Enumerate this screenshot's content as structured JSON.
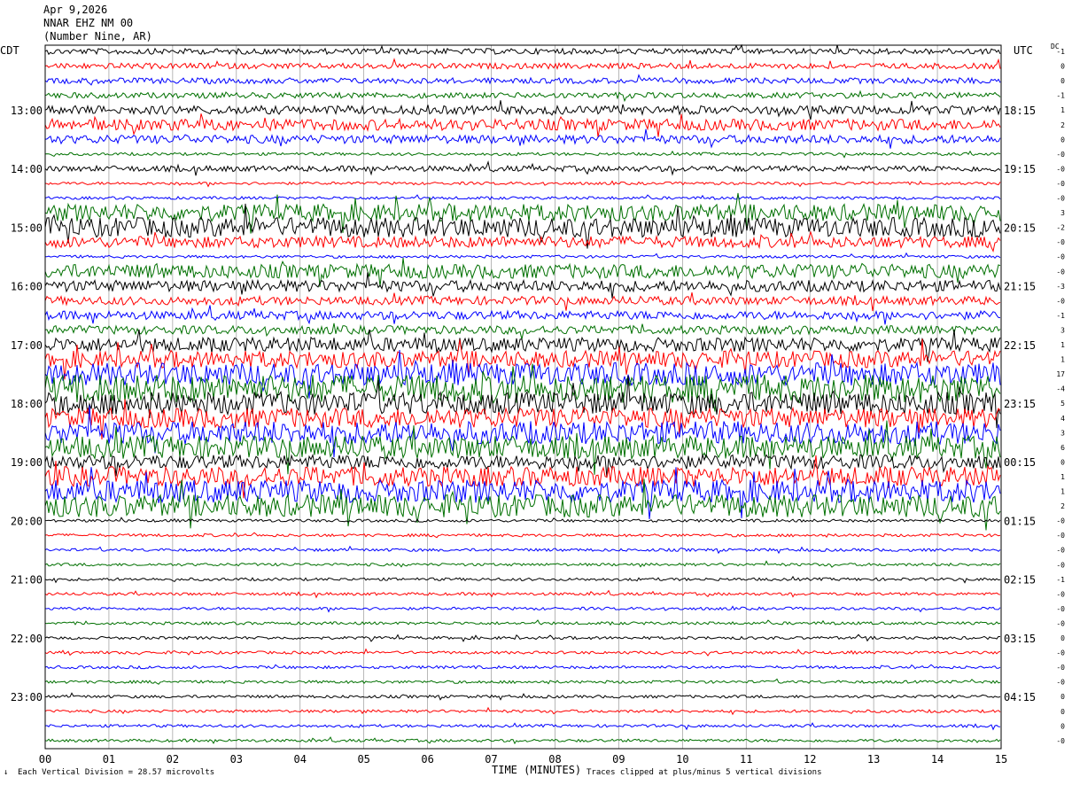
{
  "header": {
    "date": "Apr 9,2026",
    "station": "NNAR EHZ NM 00",
    "location": "(Number Nine, AR)"
  },
  "tz_left": "CDT",
  "tz_right": "UTC",
  "dc_label": "DC",
  "x_title": "TIME (MINUTES)",
  "footer_left": "Each Vertical Division =   28.57 microvolts",
  "footer_right": "Traces clipped at plus/minus 5 vertical divisions",
  "footer_mark": "↓",
  "chart_data": {
    "type": "line",
    "x_ticks": [
      "00",
      "01",
      "02",
      "03",
      "04",
      "05",
      "06",
      "07",
      "08",
      "09",
      "10",
      "11",
      "12",
      "13",
      "14",
      "15"
    ],
    "x_range": [
      0,
      15
    ],
    "left_hour_labels": [
      "13:00",
      "14:00",
      "15:00",
      "16:00",
      "17:00",
      "18:00",
      "19:00",
      "20:00",
      "21:00",
      "22:00",
      "23:00"
    ],
    "right_hour_labels": [
      "18:15",
      "19:15",
      "20:15",
      "21:15",
      "22:15",
      "23:15",
      "00:15",
      "01:15",
      "02:15",
      "03:15",
      "04:15"
    ],
    "trace_count": 48,
    "trace_colors": [
      "#000000",
      "#ff0000",
      "#0000ff",
      "#007000"
    ],
    "trace_amplitude": [
      2,
      2,
      2,
      2,
      3,
      4,
      3,
      1,
      2,
      1,
      1,
      6,
      7,
      4,
      1,
      5,
      4,
      3,
      3,
      3,
      5,
      6,
      8,
      10,
      8,
      7,
      8,
      8,
      5,
      7,
      8,
      8,
      1,
      1,
      1,
      1,
      1,
      1,
      1,
      1,
      1,
      1,
      1,
      1,
      1,
      1,
      1,
      1
    ],
    "dc_offsets": [
      "-1",
      "0",
      "0",
      "-1",
      "1",
      "2",
      "0",
      "-0",
      "-0",
      "-0",
      "-0",
      "3",
      "-2",
      "-0",
      "-0",
      "-0",
      "-3",
      "-0",
      "-1",
      "3",
      "1",
      "1",
      "17",
      "-4",
      "5",
      "4",
      "3",
      "6",
      "0",
      "1",
      "1",
      "2",
      "-0",
      "-0",
      "-0",
      "-0",
      "-1",
      "-0",
      "-0",
      "-0",
      "0",
      "-0",
      "-0",
      "-0",
      "0",
      "0",
      "0",
      "-0"
    ]
  }
}
